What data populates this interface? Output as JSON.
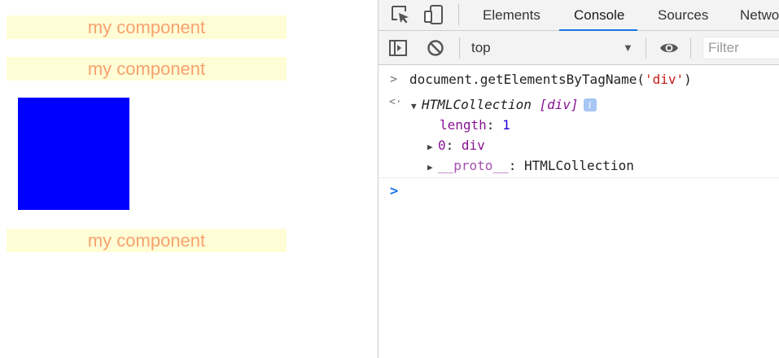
{
  "page": {
    "components": [
      {
        "label": "my component"
      },
      {
        "label": "my component"
      },
      {
        "label": "my component"
      }
    ],
    "box_color": "#0000ff"
  },
  "devtools": {
    "tabs": [
      "Elements",
      "Console",
      "Sources",
      "Netwo"
    ],
    "active_tab": "Console",
    "toolbar": {
      "context": "top",
      "filter_placeholder": "Filter"
    },
    "console": {
      "input_command": "document.getElementsByTagName(",
      "input_arg": "'div'",
      "input_close": ")",
      "result_type": "HTMLCollection",
      "result_bracket": "[div]",
      "length_key": "length",
      "length_value": "1",
      "item_key": "0",
      "item_value": "div",
      "proto_key": "__proto__",
      "proto_value": "HTMLCollection"
    }
  }
}
